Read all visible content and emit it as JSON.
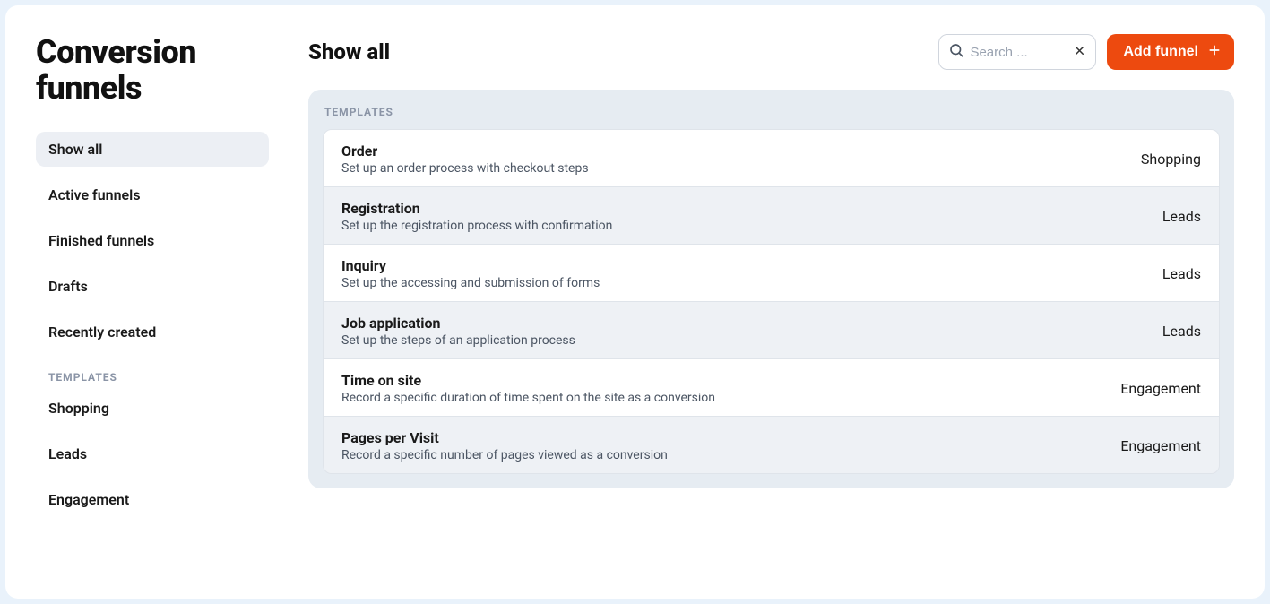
{
  "sidebar": {
    "title": "Conversion funnels",
    "nav": [
      {
        "label": "Show all",
        "active": true
      },
      {
        "label": "Active funnels",
        "active": false
      },
      {
        "label": "Finished funnels",
        "active": false
      },
      {
        "label": "Drafts",
        "active": false
      },
      {
        "label": "Recently created",
        "active": false
      }
    ],
    "templates_label": "TEMPLATES",
    "template_nav": [
      {
        "label": "Shopping"
      },
      {
        "label": "Leads"
      },
      {
        "label": "Engagement"
      }
    ]
  },
  "main": {
    "heading": "Show all",
    "search_placeholder": "Search ...",
    "add_button_label": "Add funnel",
    "panel_label": "TEMPLATES",
    "templates": [
      {
        "title": "Order",
        "desc": "Set up an order process with checkout steps",
        "category": "Shopping",
        "shade": "light"
      },
      {
        "title": "Registration",
        "desc": "Set up the registration process with confirmation",
        "category": "Leads",
        "shade": "shaded"
      },
      {
        "title": "Inquiry",
        "desc": "Set up the accessing and submission of forms",
        "category": "Leads",
        "shade": "light"
      },
      {
        "title": "Job application",
        "desc": "Set up the steps of an application process",
        "category": "Leads",
        "shade": "shaded"
      },
      {
        "title": "Time on site",
        "desc": "Record a specific duration of time spent on the site as a conversion",
        "category": "Engagement",
        "shade": "light"
      },
      {
        "title": "Pages per Visit",
        "desc": "Record a specific number of pages viewed as a conversion",
        "category": "Engagement",
        "shade": "shaded"
      }
    ]
  }
}
